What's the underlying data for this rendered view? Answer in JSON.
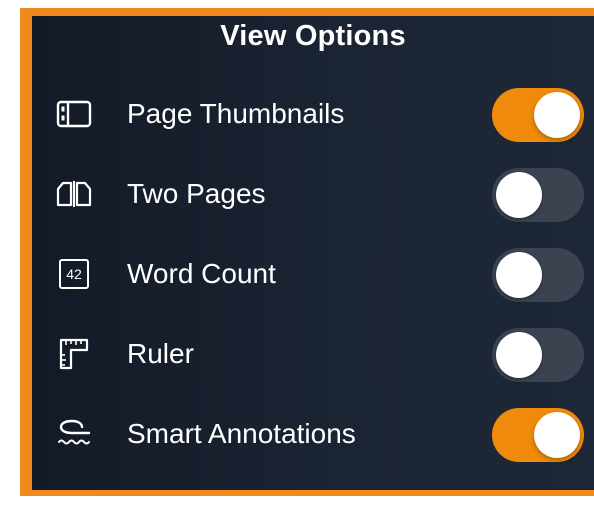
{
  "panel": {
    "title": "View Options",
    "accent_color": "#f08a0a",
    "items": [
      {
        "label": "Page Thumbnails",
        "icon": "sidebar-thumbnails-icon",
        "on": true
      },
      {
        "label": "Two Pages",
        "icon": "two-pages-icon",
        "on": false
      },
      {
        "label": "Word Count",
        "icon": "word-count-icon",
        "icon_text": "42",
        "on": false
      },
      {
        "label": "Ruler",
        "icon": "ruler-icon",
        "on": false
      },
      {
        "label": "Smart Annotations",
        "icon": "smart-annotations-icon",
        "on": true
      }
    ]
  }
}
